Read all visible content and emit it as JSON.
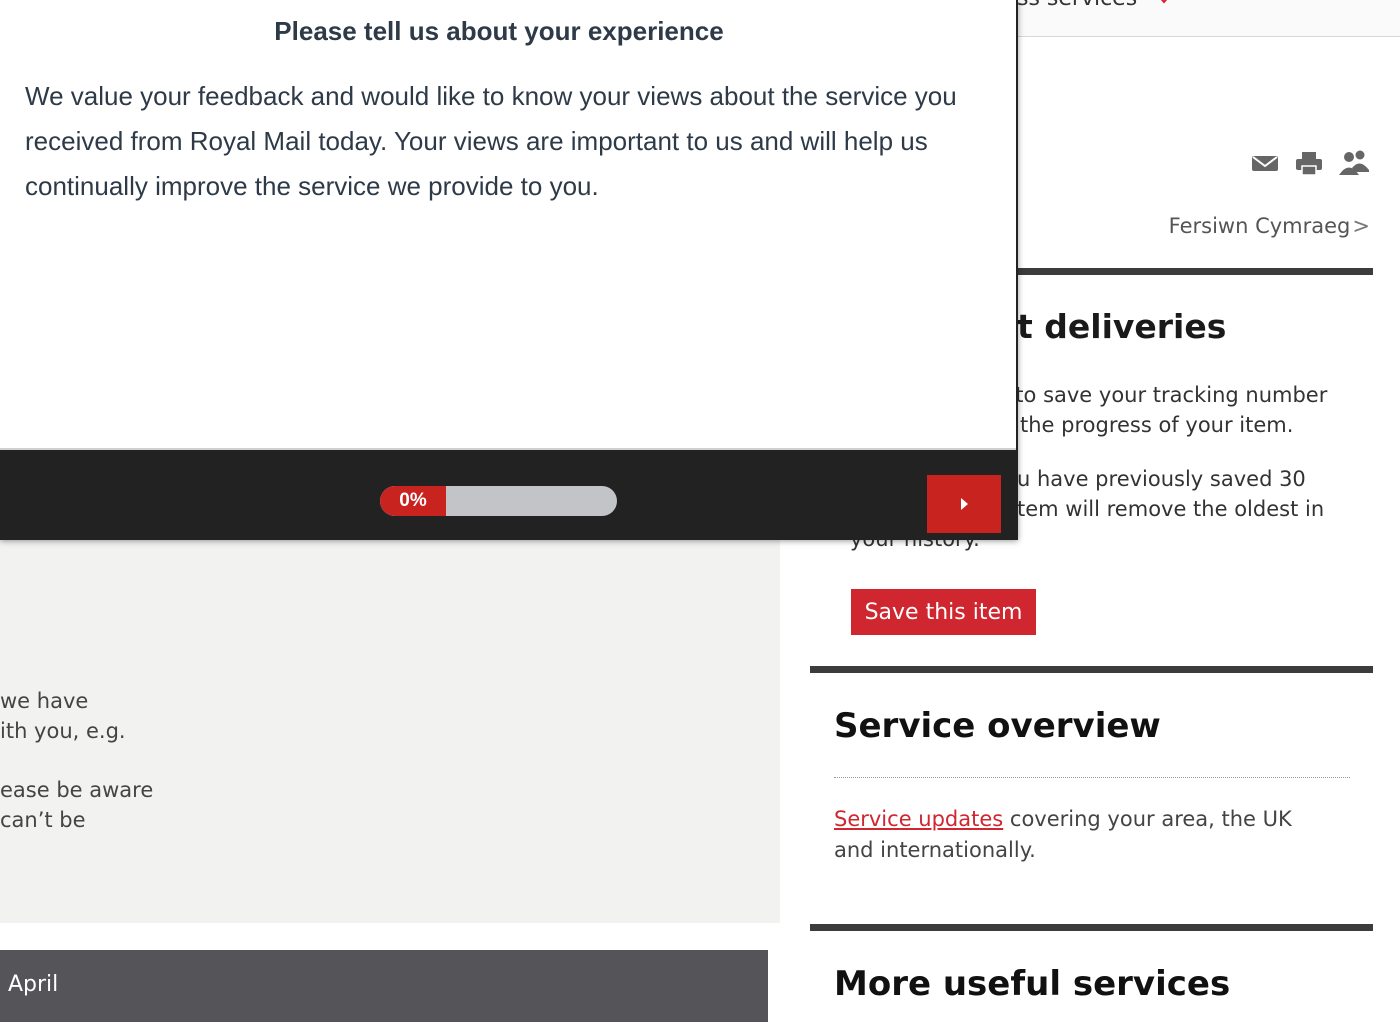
{
  "nav": {
    "partial_label": "ss services"
  },
  "language_link": {
    "label": "Fersiwn Cymraeg",
    "arrow": ">"
  },
  "tracking": {
    "heading_partial": "t deliveries",
    "para1_lines": [
      "r to save your tracking number",
      "the progress of your item."
    ],
    "para2_lines": [
      "u have previously saved 30",
      "tem will remove the oldest in",
      "your history."
    ],
    "save_button": "Save this item"
  },
  "left_panel": {
    "para1_lines": [
      "we have",
      "ith you, e.g."
    ],
    "para2_lines": [
      "ease be aware",
      "can’t be"
    ],
    "month_label": "April"
  },
  "service_overview": {
    "heading": "Service overview",
    "link_text": "Service updates",
    "text": " covering your area, the UK and internationally."
  },
  "more_services": {
    "heading": "More useful services"
  },
  "survey": {
    "title": "Please tell us about your experience",
    "body": "We value your feedback and would like to know your views about the service you received from Royal Mail today.  Your views are important to us and will help us continually improve the service we provide to you.",
    "progress_label": "0%",
    "progress_value": 0
  },
  "icons": [
    "email-icon",
    "print-icon",
    "people-icon",
    "chevron-down-icon",
    "next-arrow-icon"
  ],
  "colors": {
    "brand_red": "#d0262f",
    "footer_dark": "#222222",
    "progress_track": "#c2c4c7"
  }
}
